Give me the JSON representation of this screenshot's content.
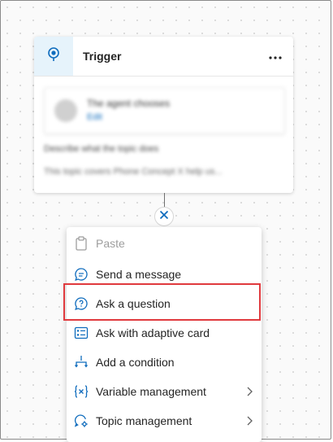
{
  "trigger": {
    "title": "Trigger",
    "more_label": "⋯",
    "inner_card": {
      "title": "The agent chooses",
      "link": "Edit"
    },
    "description_label": "Describe what the topic does",
    "description_text": "This topic covers Phone Concept X help us..."
  },
  "menu": {
    "items": [
      {
        "label": "Paste",
        "icon": "clipboard-icon",
        "enabled": false
      },
      {
        "label": "Send a message",
        "icon": "chat-bubble-icon",
        "enabled": true
      },
      {
        "label": "Ask a question",
        "icon": "question-bubble-icon",
        "enabled": true
      },
      {
        "label": "Ask with adaptive card",
        "icon": "adaptive-card-icon",
        "enabled": true
      },
      {
        "label": "Add a condition",
        "icon": "branch-icon",
        "enabled": true
      },
      {
        "label": "Variable management",
        "icon": "variable-icon",
        "enabled": true,
        "submenu": true
      },
      {
        "label": "Topic management",
        "icon": "topic-gear-icon",
        "enabled": true,
        "submenu": true
      }
    ],
    "highlighted_item": "Ask a question"
  },
  "colors": {
    "accent": "#0f6cbd",
    "highlight_border": "#e03a3e",
    "trigger_icon_bg": "#e6f3fb"
  }
}
